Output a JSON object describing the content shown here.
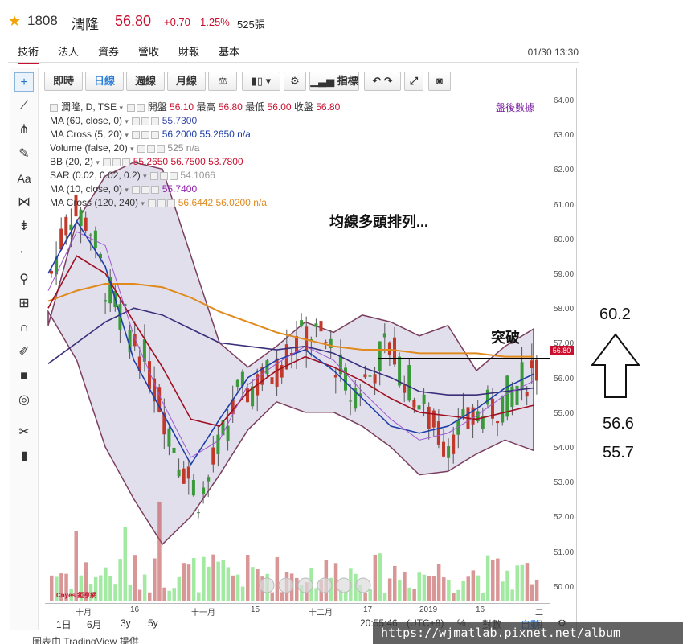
{
  "header": {
    "code": "1808",
    "name": "潤隆",
    "price": "56.80",
    "change": "+0.70",
    "change_pct": "1.25%",
    "volume": "525張"
  },
  "tabs": [
    {
      "label": "技術",
      "active": true
    },
    {
      "label": "法人"
    },
    {
      "label": "資券"
    },
    {
      "label": "營收"
    },
    {
      "label": "財報"
    },
    {
      "label": "基本"
    }
  ],
  "timestamp": "01/30 13:30",
  "toolbar": {
    "intraday": "即時",
    "daily": "日線",
    "weekly": "週線",
    "monthly": "月線",
    "indicators": "指標"
  },
  "legend": {
    "title": "潤隆, D, TSE",
    "open_lbl": "開盤",
    "open": "56.10",
    "high_lbl": "最高",
    "high": "56.80",
    "low_lbl": "最低",
    "low": "56.00",
    "close_lbl": "收盤",
    "close": "56.80",
    "rows": [
      {
        "label": "MA (60, close, 0)",
        "vals": [
          "55.7300"
        ],
        "color": "#3949ab"
      },
      {
        "label": "MA Cross (5, 20)",
        "vals": [
          "56.2000",
          "55.2650",
          "n/a"
        ],
        "color": "#1e3ea8"
      },
      {
        "label": "Volume (false, 20)",
        "vals": [
          "525",
          "n/a"
        ],
        "color": "#888888"
      },
      {
        "label": "BB (20, 2)",
        "vals": [
          "55.2650",
          "56.7500",
          "53.7800"
        ],
        "color": "#c8102e"
      },
      {
        "label": "SAR (0.02, 0.02, 0.2)",
        "vals": [
          "54.1066"
        ],
        "color": "#999999"
      },
      {
        "label": "MA (10, close, 0)",
        "vals": [
          "55.7400"
        ],
        "color": "#8e24aa"
      },
      {
        "label": "MA Cross (120, 240)",
        "vals": [
          "56.6442",
          "56.0200",
          "n/a"
        ],
        "color": "#e08a1e"
      }
    ]
  },
  "after_hours": "盤後數據",
  "yaxis": [
    "64.00",
    "63.00",
    "62.00",
    "61.00",
    "60.00",
    "59.00",
    "58.00",
    "57.00",
    "56.00",
    "55.00",
    "54.00",
    "53.00",
    "52.00",
    "51.00",
    "50.00"
  ],
  "last_price_tag": "56.80",
  "xaxis": [
    "十月",
    "16",
    "十一月",
    "15",
    "十二月",
    "17",
    "2019",
    "16",
    "二月"
  ],
  "ranges": [
    "1日",
    "6月",
    "3y",
    "5y"
  ],
  "clock": "20:55:46",
  "tz": "(UTC+8)",
  "pct_lbl": "%",
  "log_lbl": "對數",
  "auto_lbl": "自動",
  "annotations": {
    "main": "均線多頭排列...",
    "breakout": "突破",
    "target": "60.2",
    "level1": "56.6",
    "level2": "55.7"
  },
  "footer": "圖表由 TradingView 提供",
  "watermark": "https://wjmatlab.pixnet.net/album",
  "logo": "Cnyes 鉅亨網"
}
